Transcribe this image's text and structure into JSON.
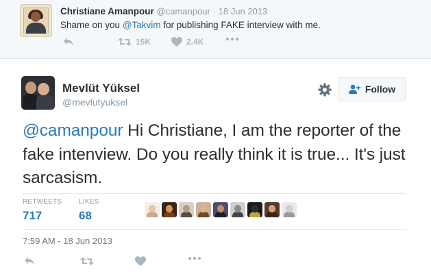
{
  "parent_tweet": {
    "author_name": "Christiane Amanpour",
    "author_handle": "@camanpour",
    "separator": "·",
    "date": "18 Jun 2013",
    "text_before": "Shame on you ",
    "mention": "@Takvim",
    "text_after": " for publishing FAKE interview with me.",
    "actions": {
      "reply_icon": "reply-arrow-icon",
      "retweet_icon": "retweet-icon",
      "retweet_count": "15K",
      "like_icon": "heart-icon",
      "like_count": "2.4K",
      "more_icon": "more-dots-icon"
    }
  },
  "main_tweet": {
    "author_name": "Mevlüt Yüksel",
    "author_handle": "@mevlutyuksel",
    "settings_icon": "gear-icon",
    "follow_button": {
      "icon": "add-user-icon",
      "label": "Follow"
    },
    "mention": "@camanpour",
    "text_after": " Hi Christiane, I am the reporter of the fake intenview. Do you really think it is true... It's just sarcasism.",
    "stats": {
      "retweets_label": "RETWEETS",
      "retweets_value": "717",
      "likes_label": "LIKES",
      "likes_value": "68"
    },
    "liker_avatars": [
      {
        "face": "#e7c3a8",
        "body": "#c9a98a",
        "bg": "#f2ede6"
      },
      {
        "face": "#d9955e",
        "body": "#7a3d1a",
        "bg": "#3b2416"
      },
      {
        "face": "#b59b86",
        "body": "#5b4c40",
        "bg": "#d8cfc4"
      },
      {
        "face": "#e0b48c",
        "body": "#6d4a2c",
        "bg": "#c9b29a"
      },
      {
        "face": "#c88a6a",
        "body": "#1e1e26",
        "bg": "#4a4f6e"
      },
      {
        "face": "#8a8a8a",
        "body": "#444444",
        "bg": "#cfcfcf"
      },
      {
        "face": "#2d2d2d",
        "body": "#c2a23c",
        "bg": "#1a1a1a"
      },
      {
        "face": "#d6a07a",
        "body": "#3a2418",
        "bg": "#5a3a26"
      },
      {
        "face": "#cfcfcf",
        "body": "#9a9a9a",
        "bg": "#e8e8e8"
      }
    ],
    "timestamp": "7:59 AM - 18 Jun 2013",
    "actions": {
      "reply_icon": "reply-arrow-icon",
      "retweet_icon": "retweet-icon",
      "like_icon": "heart-icon",
      "more_icon": "more-dots-icon"
    }
  },
  "colors": {
    "link": "#2b7bb9",
    "muted": "#8899a6",
    "action_grey": "#aab8c2",
    "text": "#292f33",
    "parent_bg": "#f5f8fa",
    "border": "#e1e8ed"
  }
}
